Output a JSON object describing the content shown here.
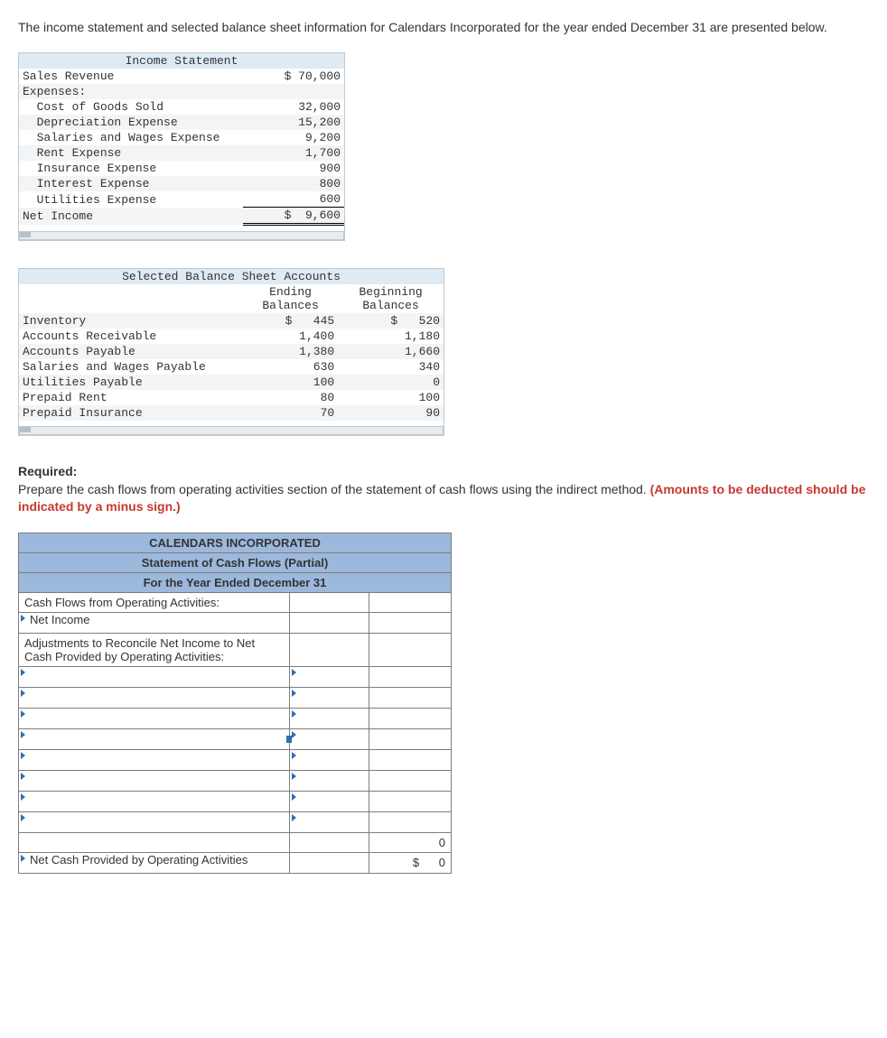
{
  "intro": "The income statement and selected balance sheet information for Calendars Incorporated for the year ended December 31 are presented below.",
  "income_statement": {
    "title": "Income Statement",
    "rows": [
      {
        "label": "Sales Revenue",
        "amount": "$ 70,000"
      },
      {
        "label": "Expenses:",
        "amount": ""
      },
      {
        "label": "  Cost of Goods Sold",
        "amount": "32,000"
      },
      {
        "label": "  Depreciation Expense",
        "amount": "15,200"
      },
      {
        "label": "  Salaries and Wages Expense",
        "amount": "9,200"
      },
      {
        "label": "  Rent Expense",
        "amount": "1,700"
      },
      {
        "label": "  Insurance Expense",
        "amount": "900"
      },
      {
        "label": "  Interest Expense",
        "amount": "800"
      },
      {
        "label": "  Utilities Expense",
        "amount": "600"
      }
    ],
    "net_label": "Net Income",
    "net_amount": "$  9,600"
  },
  "balance_sheet": {
    "title": "Selected Balance Sheet Accounts",
    "col_end": "Ending\nBalances",
    "col_beg": "Beginning\nBalances",
    "rows": [
      {
        "label": "Inventory",
        "end": "$   445",
        "beg": "$   520"
      },
      {
        "label": "Accounts Receivable",
        "end": "1,400",
        "beg": "1,180"
      },
      {
        "label": "Accounts Payable",
        "end": "1,380",
        "beg": "1,660"
      },
      {
        "label": "Salaries and Wages Payable",
        "end": "630",
        "beg": "340"
      },
      {
        "label": "Utilities Payable",
        "end": "100",
        "beg": "0"
      },
      {
        "label": "Prepaid Rent",
        "end": "80",
        "beg": "100"
      },
      {
        "label": "Prepaid Insurance",
        "end": "70",
        "beg": "90"
      }
    ]
  },
  "required": {
    "label": "Required:",
    "text": "Prepare the cash flows from operating activities section of the statement of cash flows using the indirect method. ",
    "hint": "(Amounts to be deducted should be indicated by a minus sign.)"
  },
  "cashflow": {
    "titles": [
      "CALENDARS INCORPORATED",
      "Statement of Cash Flows (Partial)",
      "For the Year Ended December 31"
    ],
    "lines": {
      "activities_header": "Cash Flows from Operating Activities:",
      "net_income": "Net Income",
      "adjustments": "Adjustments to Reconcile Net Income to Net Cash Provided by Operating Activities:",
      "subtotal": "0",
      "net_cash_label": "Net Cash Provided by Operating Activities",
      "net_cash_sym": "$",
      "net_cash_val": "0"
    }
  }
}
